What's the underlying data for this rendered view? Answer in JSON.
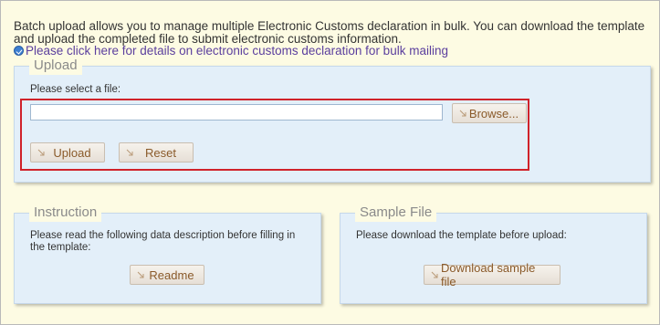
{
  "intro_text": "Batch upload allows you to manage multiple Electronic Customs declaration in bulk. You can download the template and upload the completed file to submit electronic customs information.",
  "link_text": "Please click here for details on electronic customs declaration for bulk mailing",
  "upload": {
    "legend": "Upload",
    "select_label": "Please select a file:",
    "file_value": "",
    "browse_label": "Browse...",
    "upload_label": "Upload",
    "reset_label": "Reset"
  },
  "instruction": {
    "legend": "Instruction",
    "text": "Please read the following data description before filling in the template:",
    "readme_label": "Readme"
  },
  "sample": {
    "legend": "Sample File",
    "text": "Please download the template before upload:",
    "download_label": "Download sample file"
  },
  "colors": {
    "background": "#fdfbe3",
    "panel": "#e3eff9",
    "link": "#5b3f9e",
    "button_text": "#8a5a2a",
    "highlight": "#d0222a"
  }
}
